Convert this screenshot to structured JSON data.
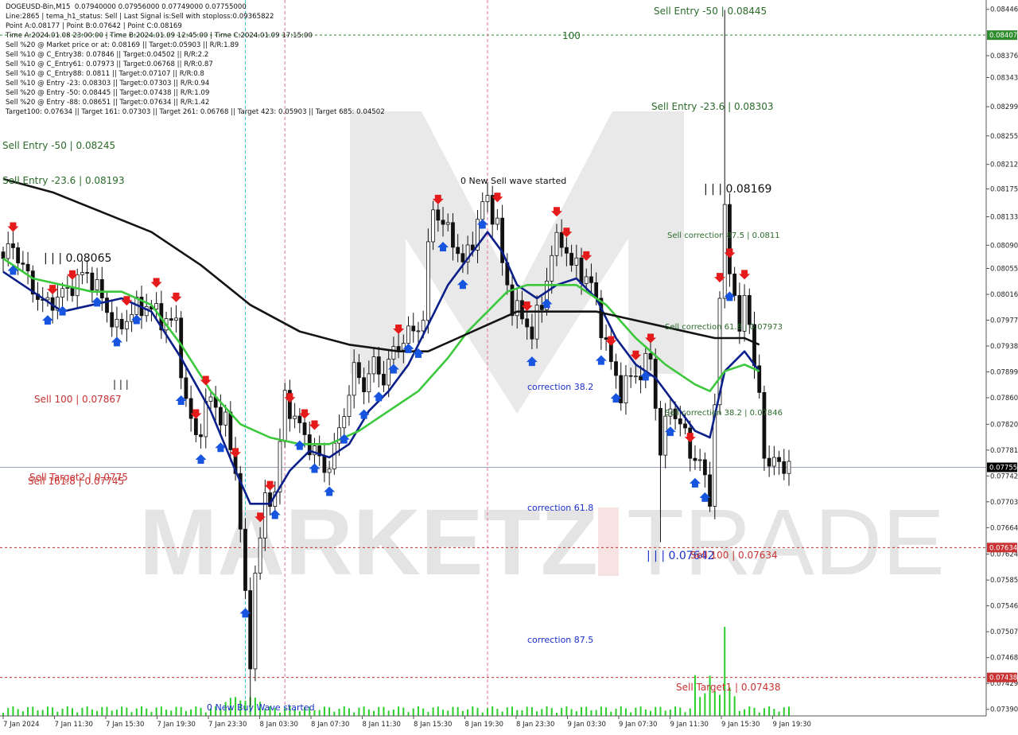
{
  "info_panel": {
    "lines": [
      "DOGEUSD-Bin,M15  0.07940000 0.07956000 0.07749000 0.07755000",
      "Line:2865 | tema_h1_status: Sell | Last Signal is:Sell with stoploss:0.09365822",
      "Point A:0.08177 | Point B:0.07642 | Point C:0.08169",
      "Time A:2024.01.08 23:00:00 | Time B:2024.01.09 12:45:00 | Time C:2024.01.09 17:15:00",
      "Sell %20 @ Market price or at: 0.08169 || Target:0.05903 || R/R:1.89",
      "Sell %10 @ C_Entry38: 0.07846 || Target:0.04502 || R/R:2.2",
      "Sell %10 @ C_Entry61: 0.07973 || Target:0.06768 || R/R:0.87",
      "Sell %10 @ C_Entry88: 0.0811 || Target:0.07107 || R/R:0.8",
      "Sell %10 @ Entry -23: 0.08303 || Target:0.07303 || R/R:0.94",
      "Sell %20 @ Entry -50: 0.08445 || Target:0.07438 || R/R:1.09",
      "Sell %20 @ Entry -88: 0.08651 || Target:0.07634 || R/R:1.42",
      "Target100: 0.07634 || Target 161: 0.07303 || Target 261: 0.06768 || Target 423: 0.05903 || Target 685: 0.04502"
    ]
  },
  "chart_data": {
    "type": "candlestick",
    "symbol": "DOGEUSD-Bin",
    "timeframe": "M15",
    "ohlc_last": {
      "open": 0.0794,
      "high": 0.07956,
      "low": 0.07749,
      "close": 0.07755
    },
    "price_axis": {
      "ylim": [
        0.0738,
        0.0846
      ],
      "ticks": [
        "0.08446",
        "0.08376",
        "0.08343",
        "0.08299",
        "0.08255",
        "0.08212",
        "0.08175",
        "0.08133",
        "0.08090",
        "0.08055",
        "0.08016",
        "0.07977",
        "0.07938",
        "0.07899",
        "0.07860",
        "0.07820",
        "0.07781",
        "0.07742",
        "0.07703",
        "0.07664",
        "0.07624",
        "0.07585",
        "0.07546",
        "0.07507",
        "0.07468",
        "0.07429",
        "0.07390"
      ],
      "badges": [
        {
          "label": "0.08407",
          "value": 0.08407,
          "color": "#2e8b2e"
        },
        {
          "label": "0.07755",
          "value": 0.07755,
          "color": "#000000"
        },
        {
          "label": "0.07634",
          "value": 0.07634,
          "color": "#c83232"
        },
        {
          "label": "0.07438",
          "value": 0.07438,
          "color": "#c83232"
        }
      ]
    },
    "time_axis": {
      "labels": [
        "7 Jan 2024",
        "7 Jan 11:30",
        "7 Jan 15:30",
        "7 Jan 19:30",
        "7 Jan 23:30",
        "8 Jan 03:30",
        "8 Jan 07:30",
        "8 Jan 11:30",
        "8 Jan 15:30",
        "8 Jan 19:30",
        "8 Jan 23:30",
        "9 Jan 03:30",
        "9 Jan 07:30",
        "9 Jan 11:30",
        "9 Jan 15:30",
        "9 Jan 19:30"
      ],
      "count": 160
    },
    "horizontal_lines": [
      {
        "value": 0.08407,
        "color": "#2e8b2e",
        "style": "dashed"
      },
      {
        "value": 0.07755,
        "color": "#9aa5b5",
        "style": "solid"
      },
      {
        "value": 0.07634,
        "color": "#c83232",
        "style": "dashed"
      },
      {
        "value": 0.07438,
        "color": "#c83232",
        "style": "dashed"
      }
    ],
    "vertical_lines": [
      {
        "index": 49,
        "color": "#33c6d6"
      },
      {
        "index": 57,
        "color": "#e66fa0"
      },
      {
        "index": 98,
        "color": "#e66fa0"
      }
    ],
    "close_path": [
      [
        0,
        0.0807
      ],
      [
        2,
        0.0809
      ],
      [
        5,
        0.0804
      ],
      [
        8,
        0.08
      ],
      [
        11,
        0.0801
      ],
      [
        14,
        0.0803
      ],
      [
        17,
        0.0805
      ],
      [
        20,
        0.0801
      ],
      [
        23,
        0.0796
      ],
      [
        26,
        0.0799
      ],
      [
        29,
        0.08
      ],
      [
        32,
        0.0798
      ],
      [
        35,
        0.0797
      ],
      [
        37,
        0.0785
      ],
      [
        39,
        0.078
      ],
      [
        42,
        0.0786
      ],
      [
        45,
        0.0782
      ],
      [
        47,
        0.0775
      ],
      [
        48,
        0.0767
      ],
      [
        49,
        0.0755
      ],
      [
        50,
        0.0746
      ],
      [
        51,
        0.076
      ],
      [
        53,
        0.077
      ],
      [
        55,
        0.0772
      ],
      [
        57,
        0.0786
      ],
      [
        59,
        0.0783
      ],
      [
        61,
        0.078
      ],
      [
        63,
        0.0778
      ],
      [
        65,
        0.0775
      ],
      [
        67,
        0.0778
      ],
      [
        69,
        0.0784
      ],
      [
        71,
        0.079
      ],
      [
        73,
        0.0788
      ],
      [
        75,
        0.0791
      ],
      [
        77,
        0.0789
      ],
      [
        79,
        0.0793
      ],
      [
        81,
        0.0795
      ],
      [
        83,
        0.0796
      ],
      [
        85,
        0.0798
      ],
      [
        86,
        0.0808
      ],
      [
        87,
        0.0815
      ],
      [
        89,
        0.0812
      ],
      [
        91,
        0.081
      ],
      [
        93,
        0.0806
      ],
      [
        95,
        0.081
      ],
      [
        97,
        0.0815
      ],
      [
        98,
        0.0816
      ],
      [
        100,
        0.0812
      ],
      [
        101,
        0.0806
      ],
      [
        103,
        0.08
      ],
      [
        105,
        0.0798
      ],
      [
        107,
        0.0796
      ],
      [
        109,
        0.08
      ],
      [
        111,
        0.0808
      ],
      [
        113,
        0.081
      ],
      [
        115,
        0.0806
      ],
      [
        117,
        0.0805
      ],
      [
        119,
        0.0803
      ],
      [
        121,
        0.0797
      ],
      [
        123,
        0.0791
      ],
      [
        125,
        0.0787
      ],
      [
        127,
        0.0789
      ],
      [
        129,
        0.079
      ],
      [
        131,
        0.0792
      ],
      [
        133,
        0.0778
      ],
      [
        135,
        0.0785
      ],
      [
        137,
        0.0782
      ],
      [
        139,
        0.0778
      ],
      [
        141,
        0.0776
      ],
      [
        143,
        0.0771
      ],
      [
        144,
        0.0785
      ],
      [
        145,
        0.08
      ],
      [
        146,
        0.0815
      ],
      [
        147,
        0.0806
      ],
      [
        148,
        0.0801
      ],
      [
        149,
        0.0795
      ],
      [
        150,
        0.0802
      ],
      [
        151,
        0.0798
      ],
      [
        152,
        0.079
      ],
      [
        153,
        0.0786
      ],
      [
        154,
        0.0778
      ],
      [
        155,
        0.0776
      ]
    ],
    "series": [
      {
        "name": "",
        "color": "#0b1f8a",
        "points": [
          [
            0,
            0.0805
          ],
          [
            6,
            0.0802
          ],
          [
            12,
            0.0799
          ],
          [
            18,
            0.08
          ],
          [
            24,
            0.0801
          ],
          [
            30,
            0.0799
          ],
          [
            36,
            0.0792
          ],
          [
            42,
            0.0784
          ],
          [
            47,
            0.0775
          ],
          [
            50,
            0.077
          ],
          [
            54,
            0.077
          ],
          [
            58,
            0.0775
          ],
          [
            62,
            0.0778
          ],
          [
            66,
            0.0777
          ],
          [
            70,
            0.0779
          ],
          [
            74,
            0.0784
          ],
          [
            78,
            0.0787
          ],
          [
            82,
            0.0791
          ],
          [
            86,
            0.0797
          ],
          [
            90,
            0.0803
          ],
          [
            94,
            0.0807
          ],
          [
            98,
            0.0811
          ],
          [
            101,
            0.0808
          ],
          [
            104,
            0.0803
          ],
          [
            108,
            0.0801
          ],
          [
            112,
            0.0803
          ],
          [
            116,
            0.0804
          ],
          [
            120,
            0.0801
          ],
          [
            124,
            0.0795
          ],
          [
            128,
            0.0791
          ],
          [
            132,
            0.0789
          ],
          [
            136,
            0.0785
          ],
          [
            140,
            0.0781
          ],
          [
            143,
            0.078
          ],
          [
            146,
            0.079
          ],
          [
            150,
            0.0793
          ],
          [
            153,
            0.079
          ]
        ]
      },
      {
        "name": "",
        "color": "#3cc83c",
        "points": [
          [
            0,
            0.0807
          ],
          [
            6,
            0.0804
          ],
          [
            12,
            0.0803
          ],
          [
            18,
            0.0802
          ],
          [
            24,
            0.0802
          ],
          [
            30,
            0.08
          ],
          [
            36,
            0.0794
          ],
          [
            42,
            0.0787
          ],
          [
            48,
            0.0782
          ],
          [
            54,
            0.078
          ],
          [
            60,
            0.0779
          ],
          [
            66,
            0.0779
          ],
          [
            72,
            0.0781
          ],
          [
            78,
            0.0784
          ],
          [
            84,
            0.0787
          ],
          [
            90,
            0.0792
          ],
          [
            94,
            0.0796
          ],
          [
            98,
            0.0799
          ],
          [
            102,
            0.0802
          ],
          [
            106,
            0.0803
          ],
          [
            110,
            0.0803
          ],
          [
            116,
            0.0803
          ],
          [
            122,
            0.08
          ],
          [
            128,
            0.0795
          ],
          [
            134,
            0.0791
          ],
          [
            140,
            0.0788
          ],
          [
            143,
            0.0787
          ],
          [
            146,
            0.079
          ],
          [
            150,
            0.0791
          ],
          [
            153,
            0.079
          ]
        ]
      },
      {
        "name": "",
        "color": "#141414",
        "points": [
          [
            0,
            0.0819
          ],
          [
            10,
            0.0817
          ],
          [
            20,
            0.0814
          ],
          [
            30,
            0.0811
          ],
          [
            40,
            0.0806
          ],
          [
            50,
            0.08
          ],
          [
            60,
            0.0796
          ],
          [
            70,
            0.0794
          ],
          [
            80,
            0.0793
          ],
          [
            86,
            0.0793
          ],
          [
            92,
            0.0795
          ],
          [
            98,
            0.0797
          ],
          [
            104,
            0.0799
          ],
          [
            110,
            0.0799
          ],
          [
            116,
            0.0799
          ],
          [
            120,
            0.0799
          ],
          [
            126,
            0.0798
          ],
          [
            132,
            0.0797
          ],
          [
            138,
            0.0796
          ],
          [
            144,
            0.0795
          ],
          [
            150,
            0.0795
          ],
          [
            153,
            0.0794
          ]
        ]
      }
    ],
    "annotations": [
      {
        "text": "Sell Entry -50 | 0.08445",
        "color": "#2b6b2b"
      },
      {
        "text": "100",
        "color": "#2b6b2b"
      },
      {
        "text": "Sell Entry -23.6 | 0.08303",
        "color": "#2b6b2b"
      },
      {
        "text": "Sell Entry -50 | 0.08245",
        "color": "#2b6b2b"
      },
      {
        "text": "Sell Entry -23.6 | 0.08193",
        "color": "#2b6b2b"
      },
      {
        "text": "0 New Sell wave started",
        "color": "#111111"
      },
      {
        "text": "| | | 0.08169",
        "color": "#111111"
      },
      {
        "text": "Sell correction 87.5 | 0.0811",
        "color": "#2b6b2b"
      },
      {
        "text": "| | | 0.08065",
        "color": "#111111"
      },
      {
        "text": "Sell correction 61.8 | 0.07973",
        "color": "#2b6b2b"
      },
      {
        "text": "correction 38.2",
        "color": "#1a2fc8"
      },
      {
        "text": "| | |",
        "color": "#111111"
      },
      {
        "text": "Sell 100 | 0.07867",
        "color": "#c83232"
      },
      {
        "text": "Sell correction 38.2 | 0.07846",
        "color": "#2b6b2b"
      },
      {
        "text": "Sell Target2 | 0.0775",
        "color": "#c83232"
      },
      {
        "text": "Sell 161.8 | 0.07745",
        "color": "#c83232"
      },
      {
        "text": "correction 61.8",
        "color": "#1a2fc8"
      },
      {
        "text": "| | | 0.07642",
        "color": "#1a2fc8"
      },
      {
        "text": "Sell 100 | 0.07634",
        "color": "#c83232"
      },
      {
        "text": "correction 87.5",
        "color": "#1a2fc8"
      },
      {
        "text": "Sell Target1 | 0.07438",
        "color": "#c83232"
      },
      {
        "text": "0 New Buy Wave started",
        "color": "#1a2fc8"
      }
    ],
    "sell_arrows": [
      2,
      10,
      14,
      25,
      31,
      35,
      39,
      41,
      47,
      52,
      54,
      58,
      61,
      63,
      80,
      88,
      100,
      106,
      112,
      114,
      118,
      123,
      128,
      131,
      139,
      145,
      147,
      150
    ],
    "buy_arrows": [
      2,
      9,
      12,
      19,
      23,
      27,
      36,
      40,
      44,
      49,
      55,
      60,
      63,
      66,
      69,
      73,
      76,
      79,
      82,
      84,
      89,
      93,
      97,
      107,
      110,
      121,
      124,
      130,
      135,
      140,
      142,
      147
    ]
  },
  "watermark": {
    "text_left": "MARKETZ",
    "text_right": "TRADE"
  },
  "colors": {
    "candle": "#111111",
    "grid": "#d0d0d0",
    "sell_arrow": "#e51b1b",
    "buy_arrow": "#1755e0",
    "volume": "#29cf29"
  }
}
